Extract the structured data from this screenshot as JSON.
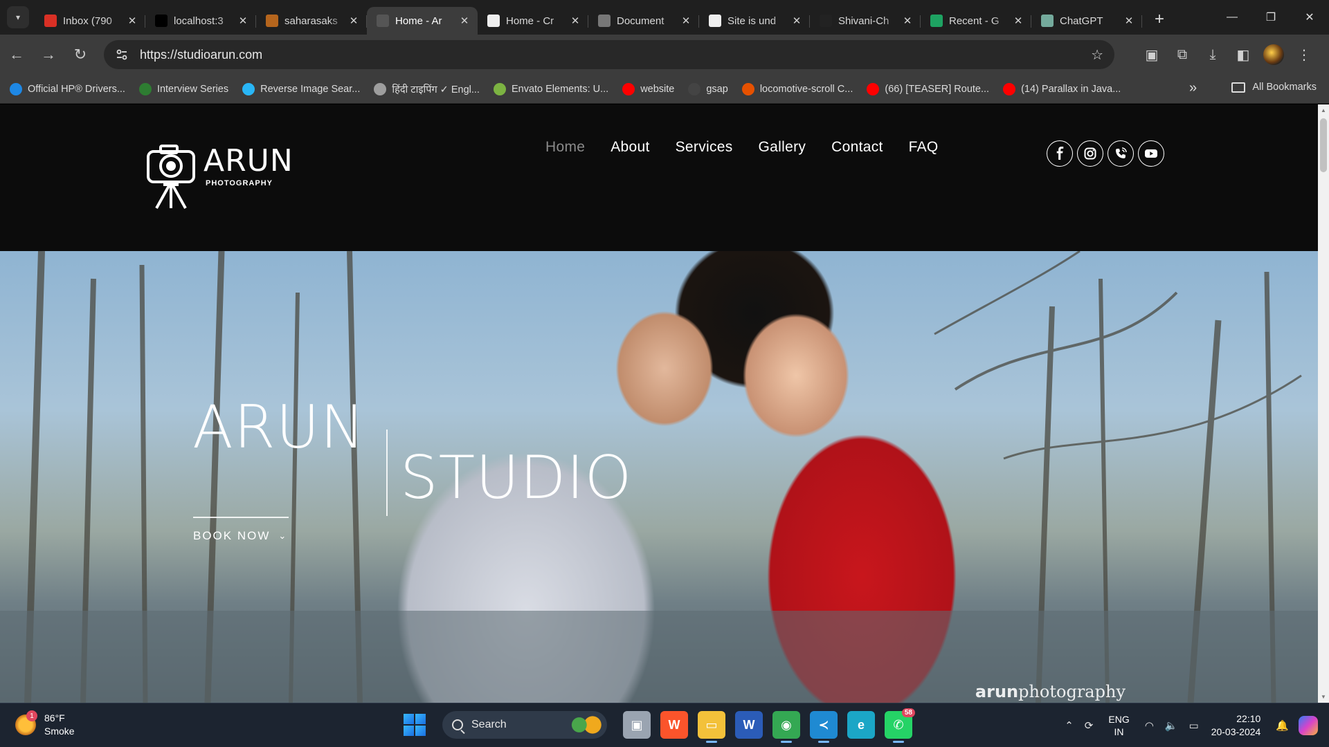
{
  "browser": {
    "tabs": [
      {
        "title": "Inbox (790",
        "favicon": "gmail-icon",
        "active": false
      },
      {
        "title": "localhost:3",
        "favicon": "vercel-icon",
        "active": false
      },
      {
        "title": "saharasaks",
        "favicon": "site-icon",
        "active": false
      },
      {
        "title": "Home - Ar",
        "favicon": "arun-icon",
        "active": true
      },
      {
        "title": "Home - Cr",
        "favicon": "page-icon",
        "active": false
      },
      {
        "title": "Document",
        "favicon": "globe-icon",
        "active": false
      },
      {
        "title": "Site is und",
        "favicon": "page-icon",
        "active": false
      },
      {
        "title": "Shivani-Ch",
        "favicon": "github-icon",
        "active": false
      },
      {
        "title": "Recent - G",
        "favicon": "drive-icon",
        "active": false
      },
      {
        "title": "ChatGPT",
        "favicon": "chatgpt-icon",
        "active": false
      }
    ],
    "url": "https://studioarun.com",
    "bookmarks": [
      {
        "label": "Official HP® Drivers...",
        "color": "#1e88e5"
      },
      {
        "label": "Interview Series",
        "color": "#2e7d32"
      },
      {
        "label": "Reverse Image Sear...",
        "color": "#29b6f6"
      },
      {
        "label": "हिंदी टाइपिंग ✓ Engl...",
        "color": "#9e9e9e"
      },
      {
        "label": "Envato Elements: U...",
        "color": "#7cb342"
      },
      {
        "label": "website",
        "color": "#ff0000"
      },
      {
        "label": "gsap",
        "color": "#444444"
      },
      {
        "label": "locomotive-scroll C...",
        "color": "#e65100"
      },
      {
        "label": "(66) [TEASER] Route...",
        "color": "#ff0000"
      },
      {
        "label": "(14) Parallax in Java...",
        "color": "#ff0000"
      }
    ],
    "all_bookmarks": "All Bookmarks"
  },
  "site": {
    "brand_name": "ARUN",
    "brand_sub": "PHOTOGRAPHY",
    "nav": [
      "Home",
      "About",
      "Services",
      "Gallery",
      "Contact",
      "FAQ"
    ],
    "current_nav": "Home",
    "socials": [
      "facebook-icon",
      "instagram-icon",
      "phone-icon",
      "youtube-icon"
    ],
    "hero": {
      "title_a": "ARUN",
      "title_b": "STUDIO",
      "cta": "BOOK NOW",
      "watermark_bold": "arun",
      "watermark_rest": "photography"
    }
  },
  "taskbar": {
    "weather_temp": "86°F",
    "weather_desc": "Smoke",
    "weather_badge": "1",
    "search_label": "Search",
    "apps": [
      {
        "name": "task-view",
        "color": "#9aa4b1",
        "glyph": "▣"
      },
      {
        "name": "brave",
        "color": "#fb542b",
        "glyph": "W"
      },
      {
        "name": "file-explorer",
        "color": "#f3c13a",
        "glyph": "▭"
      },
      {
        "name": "word",
        "color": "#2b5cb8",
        "glyph": "W"
      },
      {
        "name": "chrome",
        "color": "#34a853",
        "glyph": "◉"
      },
      {
        "name": "vscode",
        "color": "#1f8ad2",
        "glyph": "≺"
      },
      {
        "name": "edge",
        "color": "#1ba6c6",
        "glyph": "e"
      },
      {
        "name": "whatsapp",
        "color": "#25d366",
        "glyph": "✆",
        "count": "58"
      }
    ],
    "lang_top": "ENG",
    "lang_bottom": "IN",
    "time": "22:10",
    "date": "20-03-2024"
  }
}
